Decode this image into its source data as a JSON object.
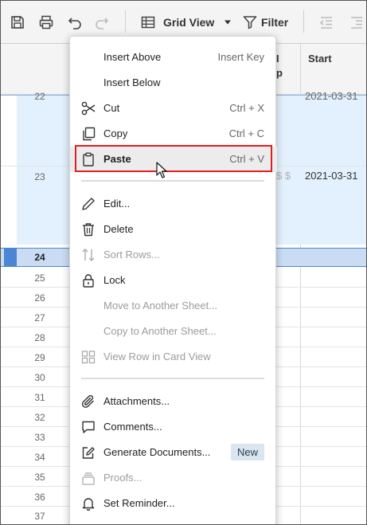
{
  "toolbar": {
    "view_label": "Grid View",
    "filter_label": "Filter"
  },
  "columns": {
    "partial_header": "I\np",
    "start_header": "Start"
  },
  "rows": [
    {
      "num": "22",
      "start": "2021-03-31"
    },
    {
      "num": "23",
      "start": "2021-03-31",
      "extra": "$ $"
    },
    {
      "num": "24"
    },
    {
      "num": "25"
    },
    {
      "num": "26"
    },
    {
      "num": "27"
    },
    {
      "num": "28"
    },
    {
      "num": "29"
    },
    {
      "num": "30"
    },
    {
      "num": "31"
    },
    {
      "num": "32"
    },
    {
      "num": "33"
    },
    {
      "num": "34"
    },
    {
      "num": "35"
    },
    {
      "num": "36"
    },
    {
      "num": "37"
    }
  ],
  "menu": {
    "insert_above": {
      "label": "Insert Above",
      "shortcut": "Insert Key"
    },
    "insert_below": {
      "label": "Insert Below"
    },
    "cut": {
      "label": "Cut",
      "shortcut": "Ctrl + X"
    },
    "copy": {
      "label": "Copy",
      "shortcut": "Ctrl + C"
    },
    "paste": {
      "label": "Paste",
      "shortcut": "Ctrl + V"
    },
    "edit": {
      "label": "Edit..."
    },
    "delete": {
      "label": "Delete"
    },
    "sort_rows": {
      "label": "Sort Rows..."
    },
    "lock": {
      "label": "Lock"
    },
    "move_sheet": {
      "label": "Move to Another Sheet..."
    },
    "copy_sheet": {
      "label": "Copy to Another Sheet..."
    },
    "card_view": {
      "label": "View Row in Card View"
    },
    "attachments": {
      "label": "Attachments..."
    },
    "comments": {
      "label": "Comments..."
    },
    "generate_docs": {
      "label": "Generate Documents...",
      "badge": "New"
    },
    "proofs": {
      "label": "Proofs..."
    },
    "reminder": {
      "label": "Set Reminder..."
    }
  },
  "colors": {
    "selected_row_bg": "#c9dcf3",
    "highlight_rows_bg": "#e3f0fd",
    "accent_blue": "#4a86d4",
    "paste_outline": "#e02020"
  }
}
